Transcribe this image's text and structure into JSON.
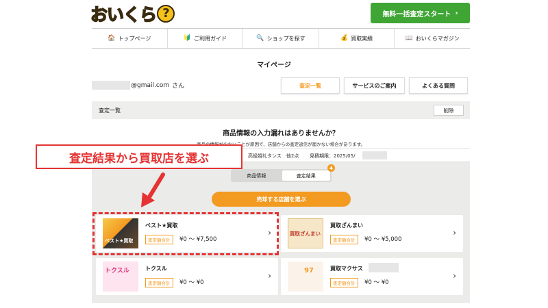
{
  "header": {
    "logo_text": "おいくら",
    "logo_mark": "?",
    "cta_label": "無料一括査定スタート",
    "cta_arrow": "›"
  },
  "nav": [
    {
      "label": "トップページ",
      "icon": "house-icon",
      "glyph": "🏠"
    },
    {
      "label": "ご利用ガイド",
      "icon": "beginner-mark-icon",
      "glyph": "🔰"
    },
    {
      "label": "ショップを探す",
      "icon": "search-icon",
      "glyph": "🔍"
    },
    {
      "label": "買取実績",
      "icon": "yen-coin-icon",
      "glyph": "💰"
    },
    {
      "label": "おいくらマガジン",
      "icon": "book-icon",
      "glyph": "📖"
    }
  ],
  "page": {
    "title": "マイページ",
    "user_email_suffix": "@gmail.com",
    "user_honorific": "さん"
  },
  "top_buttons": [
    {
      "label": "査定一覧",
      "active": true
    },
    {
      "label": "サービスのご案内",
      "active": false
    },
    {
      "label": "よくある質問",
      "active": false
    }
  ],
  "section": {
    "title": "査定一覧",
    "delete_label": "削除"
  },
  "notice": {
    "title": "商品情報の入力漏れはありませんか？",
    "subtitle": "商品の情報が少ないことが原因で、店舗からの査定返信が届かない場合があります。"
  },
  "item": {
    "summary": "高級婚礼タンス　他2点",
    "deadline": "見積期限：2025/05/"
  },
  "tabs": [
    {
      "label": "商品情報",
      "active": false
    },
    {
      "label": "査定結果",
      "active": true
    }
  ],
  "badge_count": "4",
  "sell_button_label": "売却する店舗を選ぶ",
  "shops": [
    {
      "name": "ベスト★買取",
      "tag": "査定額合計",
      "price": "¥0 〜 ¥7,500",
      "thumb": "best"
    },
    {
      "name": "買取ざんまい",
      "tag": "査定額合計",
      "price": "¥0 〜 ¥5,000",
      "thumb": "zanmai"
    },
    {
      "name": "トクスル",
      "tag": "査定額合計",
      "price": "¥0 〜 ¥0",
      "thumb": "tokusuru"
    },
    {
      "name": "買取マクサス",
      "tag": "査定額合計",
      "price": "¥0 〜 ¥0",
      "thumb": "makusasu"
    }
  ],
  "annotation": {
    "callout_text": "査定結果から買取店を選ぶ"
  },
  "colors": {
    "accent": "#f39a21",
    "cta_green": "#3fa535",
    "annotation_red": "#e53333"
  }
}
